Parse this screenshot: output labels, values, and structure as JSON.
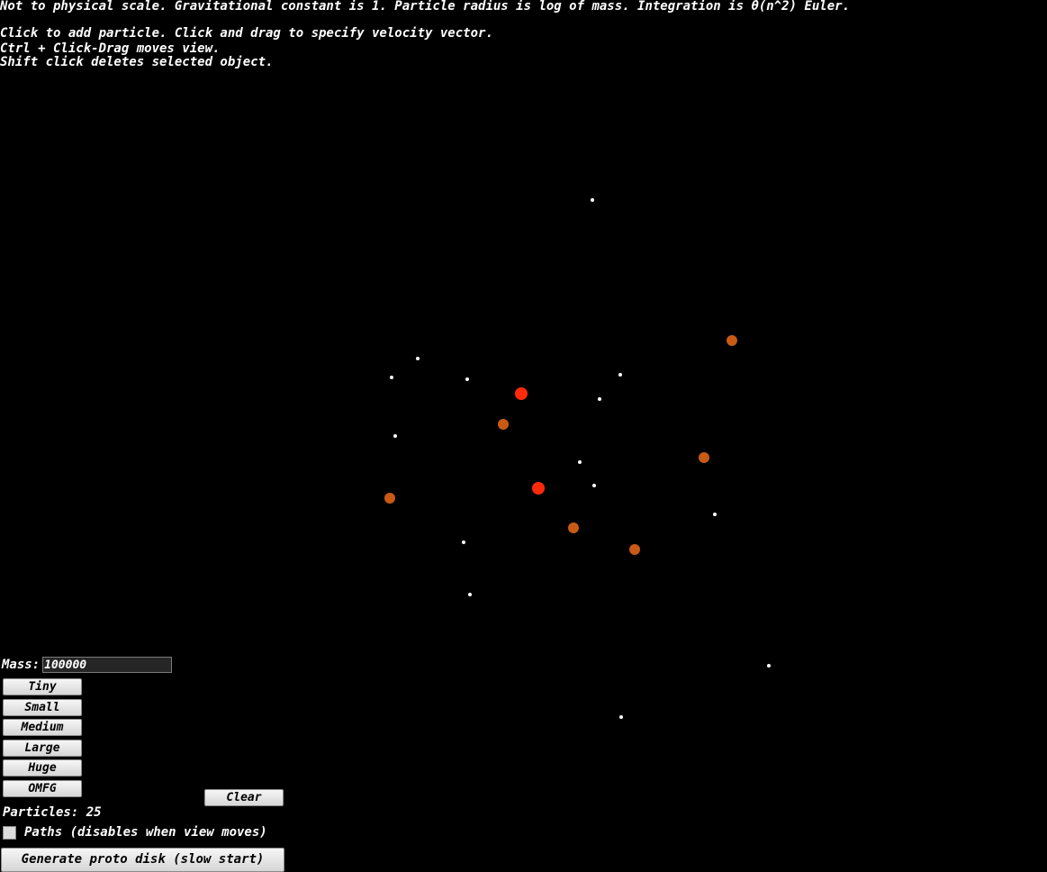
{
  "info": {
    "line1": "Not to physical scale. Gravitational constant is 1. Particle radius is log of mass. Integration is θ(n^2) Euler.",
    "line2": "Click to add particle. Click and drag to specify velocity vector.",
    "line3": "Ctrl + Click-Drag moves view.",
    "line4": "Shift click deletes selected object."
  },
  "controls": {
    "mass_label": "Mass:",
    "mass_value": "100000",
    "size_buttons": [
      "Tiny",
      "Small",
      "Medium",
      "Large",
      "Huge",
      "OMFG"
    ],
    "clear_label": "Clear",
    "particles_text": "Particles: 25",
    "paths_label": "Paths (disables when view moves)",
    "paths_checked": false,
    "proto_disk_label": "Generate proto disk (slow start)"
  },
  "colors": {
    "background": "#000000",
    "text": "#ffffff",
    "particle_small": "#ffffff",
    "particle_medium": "#c85a14",
    "particle_large": "#ff2a0a"
  }
}
